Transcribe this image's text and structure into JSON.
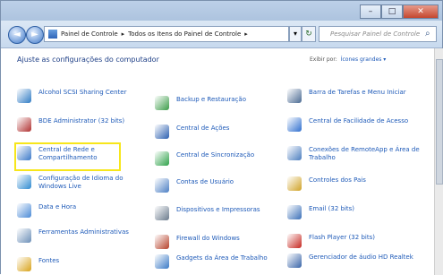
{
  "window": {
    "buttons": [
      "–",
      "□",
      "✕"
    ]
  },
  "nav": {
    "back": "◄",
    "forward": "►",
    "address_parts": [
      "Painel de Controle",
      "▸",
      "Todos os Itens do Painel de Controle",
      "▸"
    ],
    "dropdown": "▾",
    "refresh": "↻",
    "search_placeholder": "Pesquisar Painel de Controle"
  },
  "main": {
    "heading": "Ajuste as configurações do computador",
    "view_by_label": "Exibir por:",
    "view_by_value": "Ícones grandes ▾"
  },
  "items": [
    {
      "label": "Alcohol SCSI Sharing Center",
      "icon": "alcohol-icon",
      "color": "#2f7bc4"
    },
    {
      "label": "BDE Administrator (32 bits)",
      "icon": "bde-icon",
      "color": "#b03030"
    },
    {
      "label": "Central de Rede e Compartilhamento",
      "icon": "network-icon",
      "color": "#3a78c8"
    },
    {
      "label": "Configuração de Idioma do Windows Live",
      "icon": "globe-icon",
      "color": "#2e8ad0"
    },
    {
      "label": "Data e Hora",
      "icon": "clock-icon",
      "color": "#4a8ad6"
    },
    {
      "label": "Ferramentas Administrativas",
      "icon": "tools-icon",
      "color": "#6c8fb8"
    },
    {
      "label": "Fontes",
      "icon": "fonts-icon",
      "color": "#d8a31a"
    },
    {
      "label": "Backup e Restauração",
      "icon": "backup-icon",
      "color": "#3b9c48"
    },
    {
      "label": "Central de Ações",
      "icon": "flag-icon",
      "color": "#2b5fb0"
    },
    {
      "label": "Central de Sincronização",
      "icon": "sync-icon",
      "color": "#2fa24a"
    },
    {
      "label": "Contas de Usuário",
      "icon": "users-icon",
      "color": "#4c7fc4"
    },
    {
      "label": "Dispositivos e Impressoras",
      "icon": "printer-icon",
      "color": "#6a7a8c"
    },
    {
      "label": "Firewall do Windows",
      "icon": "firewall-icon",
      "color": "#b6402a"
    },
    {
      "label": "Gadgets da Área de Trabalho",
      "icon": "gadgets-icon",
      "color": "#3a7ac6"
    },
    {
      "label": "Barra de Tarefas e Menu Iniciar",
      "icon": "taskbar-icon",
      "color": "#4a6a92"
    },
    {
      "label": "Central de Facilidade de Acesso",
      "icon": "ease-icon",
      "color": "#2f6fcf"
    },
    {
      "label": "Conexões de RemoteApp e Área de Trabalho",
      "icon": "remoteapp-icon",
      "color": "#4b7dbf"
    },
    {
      "label": "Controles dos Pais",
      "icon": "parental-icon",
      "color": "#d0a226"
    },
    {
      "label": "Email (32 bits)",
      "icon": "mail-icon",
      "color": "#3a6fb8"
    },
    {
      "label": "Flash Player (32 bits)",
      "icon": "flash-icon",
      "color": "#c6261f"
    },
    {
      "label": "Gerenciador de áudio HD Realtek",
      "icon": "audio-icon",
      "color": "#3964a8"
    }
  ]
}
